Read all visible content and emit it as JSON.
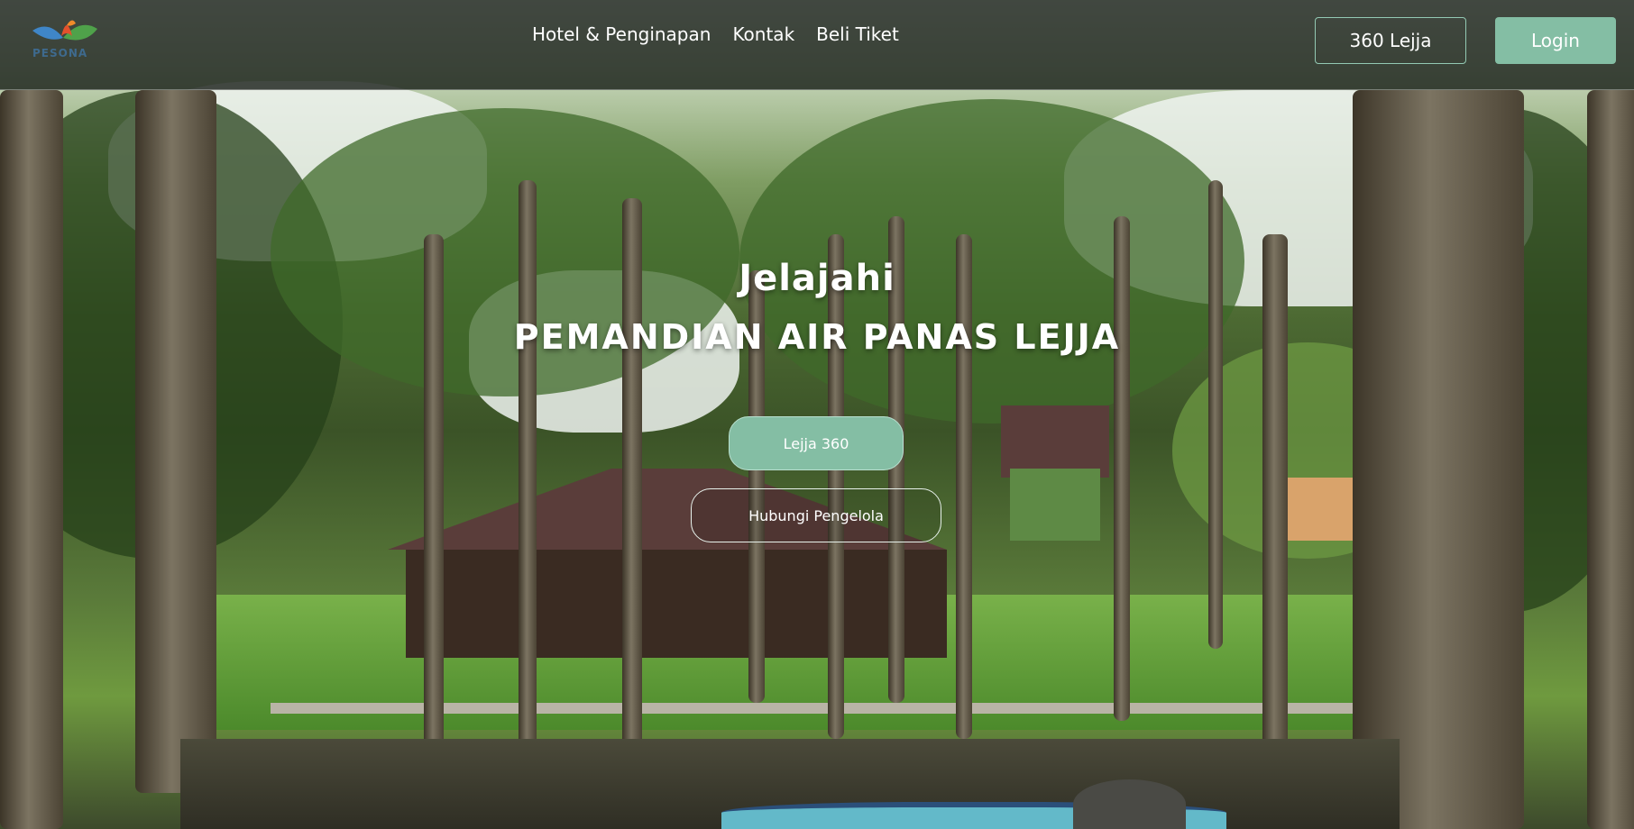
{
  "header": {
    "logo_text": "PESONA",
    "nav": [
      "Hotel & Penginapan",
      "Kontak",
      "Beli Tiket"
    ],
    "btn_360": "360 Lejja",
    "btn_login": "Login"
  },
  "hero": {
    "title": "Jelajahi",
    "subtitle": "PEMANDIAN AIR PANAS LEJJA",
    "primary_button": "Lejja 360",
    "secondary_button": "Hubungi Pengelola"
  },
  "colors": {
    "accent": "#84bea4",
    "navbar_bg": "#121812"
  }
}
